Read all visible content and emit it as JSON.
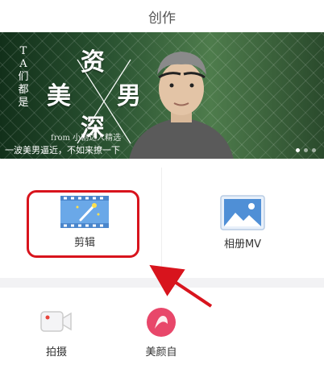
{
  "header": {
    "title": "创作"
  },
  "banner": {
    "vertical_text": [
      "T",
      "A",
      "们",
      "都",
      "是"
    ],
    "big_words": [
      "资",
      "美",
      "男",
      "深"
    ],
    "from_text": "from 小剧达人精选",
    "caption": "一波美男逼近，不如来撩一下",
    "page_count": 3,
    "active_page": 1
  },
  "tools": {
    "edit_label": "剪辑",
    "album_label": "相册MV",
    "shoot_label": "拍摄",
    "beauty_label": "美颜自"
  },
  "colors": {
    "highlight": "#d8141d",
    "arrow": "#d8141d"
  }
}
